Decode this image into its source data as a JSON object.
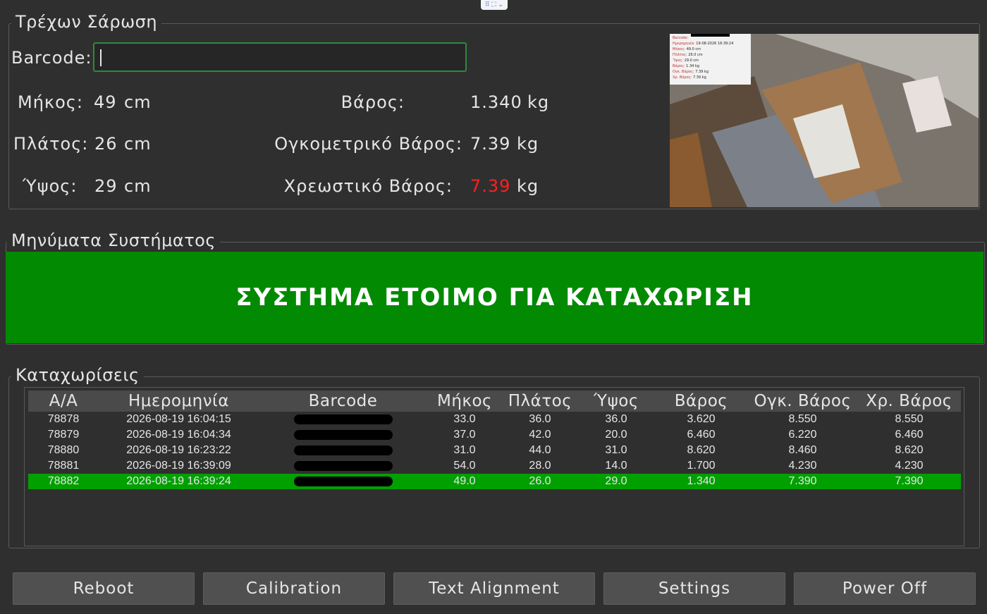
{
  "scan": {
    "title": "Τρέχων Σάρωση",
    "barcode_label": "Barcode:",
    "barcode_value": "",
    "length_label": "Μήκος:",
    "length_value": "49",
    "length_unit": "cm",
    "width_label": "Πλάτος:",
    "width_value": "26",
    "width_unit": "cm",
    "height_label": "Ύψος:",
    "height_value": "29",
    "height_unit": "cm",
    "weight_label": "Βάρος:",
    "weight_value": "1.340",
    "weight_unit": "kg",
    "vol_weight_label": "Ογκομετρικό Βάρος:",
    "vol_weight_value": "7.39",
    "vol_weight_unit": "kg",
    "charge_weight_label": "Χρεωστικό Βάρος:",
    "charge_weight_value": "7.39",
    "charge_weight_unit": "kg",
    "charge_color": "#ff2020"
  },
  "messages": {
    "title": "Μηνύματα Συστήματος",
    "status": "ΣΥΣΤΗΜΑ ΕΤΟΙΜΟ ΓΙΑ ΚΑΤΑΧΩΡΙΣΗ",
    "status_color": "#018a02"
  },
  "entries": {
    "title": "Καταχωρίσεις",
    "columns": [
      "Α/Α",
      "Ημερομηνία",
      "Barcode",
      "Μήκος",
      "Πλάτος",
      "Ύψος",
      "Βάρος",
      "Ογκ. Βάρος",
      "Χρ. Βάρος"
    ],
    "rows": [
      {
        "id": "78878",
        "date": "2026-08-19 16:04:15",
        "length": "33.0",
        "width": "36.0",
        "height": "36.0",
        "weight": "3.620",
        "vol": "8.550",
        "charge": "8.550"
      },
      {
        "id": "78879",
        "date": "2026-08-19 16:04:34",
        "length": "37.0",
        "width": "42.0",
        "height": "20.0",
        "weight": "6.460",
        "vol": "6.220",
        "charge": "6.460"
      },
      {
        "id": "78880",
        "date": "2026-08-19 16:23:22",
        "length": "31.0",
        "width": "44.0",
        "height": "31.0",
        "weight": "8.620",
        "vol": "8.460",
        "charge": "8.620"
      },
      {
        "id": "78881",
        "date": "2026-08-19 16:39:09",
        "length": "54.0",
        "width": "28.0",
        "height": "14.0",
        "weight": "1.700",
        "vol": "4.230",
        "charge": "4.230"
      },
      {
        "id": "78882",
        "date": "2026-08-19 16:39:24",
        "length": "49.0",
        "width": "26.0",
        "height": "29.0",
        "weight": "1.340",
        "vol": "7.390",
        "charge": "7.390",
        "selected": true
      }
    ]
  },
  "buttons": {
    "reboot": "Reboot",
    "calibration": "Calibration",
    "text_alignment": "Text Alignment",
    "settings": "Settings",
    "power_off": "Power Off"
  },
  "camera": {
    "icon": "camera-feed-image",
    "overlay_lines": [
      "Barcode:",
      "Ημερομηνία:",
      "Μήκος:",
      "Πλάτος:",
      "Ύψος:",
      "Βάρος:",
      "Ογκ. Βάρος:",
      "Χρ. Βάρος:"
    ],
    "overlay_values": [
      "",
      "19-08-2026 16:39:24",
      "49.0 cm",
      "26.0 cm",
      "29.0 cm",
      "1.34 kg",
      "7.39 kg",
      "7.39 kg"
    ]
  }
}
